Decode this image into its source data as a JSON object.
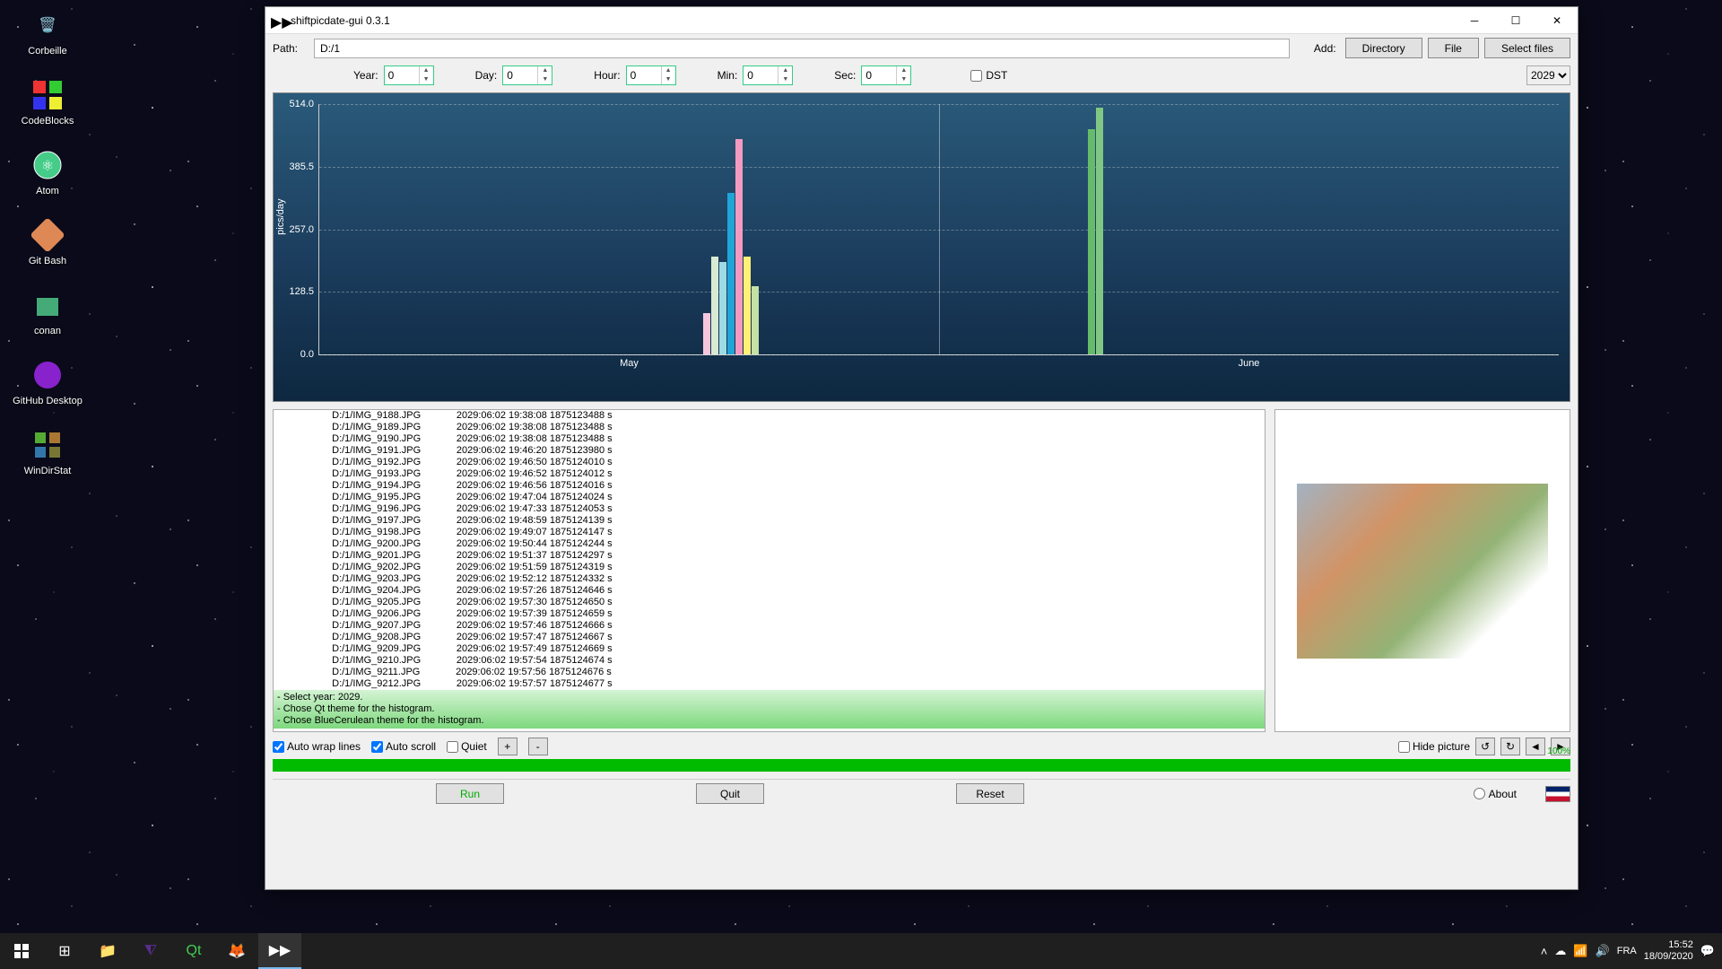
{
  "desktop": {
    "icons": [
      "Corbeille",
      "CodeBlocks",
      "Atom",
      "Git Bash",
      "conan",
      "GitHub Desktop",
      "WinDirStat"
    ]
  },
  "window": {
    "title": "shiftpicdate-gui 0.3.1",
    "path_label": "Path:",
    "path_value": "D:/1",
    "add_label": "Add:",
    "directory_btn": "Directory",
    "file_btn": "File",
    "select_files_btn": "Select files",
    "spinners": {
      "year": {
        "label": "Year:",
        "value": "0"
      },
      "day": {
        "label": "Day:",
        "value": "0"
      },
      "hour": {
        "label": "Hour:",
        "value": "0"
      },
      "min": {
        "label": "Min:",
        "value": "0"
      },
      "sec": {
        "label": "Sec:",
        "value": "0"
      }
    },
    "dst_label": "DST",
    "year_select": "2029"
  },
  "chart_data": {
    "type": "bar",
    "ylabel": "pics/day",
    "ylim": [
      0,
      514
    ],
    "yticks": [
      0.0,
      128.5,
      257.0,
      385.5,
      514.0
    ],
    "xticks": [
      "May",
      "June"
    ],
    "bar_groups": [
      {
        "pos_pct": 31,
        "bars": [
          {
            "value": 85,
            "color": "#f7c6dc"
          },
          {
            "value": 200,
            "color": "#d9ead3"
          },
          {
            "value": 190,
            "color": "#9edae5"
          },
          {
            "value": 330,
            "color": "#1fa5d8"
          },
          {
            "value": 440,
            "color": "#f49ac1"
          },
          {
            "value": 200,
            "color": "#fff176"
          },
          {
            "value": 140,
            "color": "#c5e1a5"
          }
        ]
      },
      {
        "pos_pct": 62,
        "bars": [
          {
            "value": 460,
            "color": "#66bb6a"
          },
          {
            "value": 505,
            "color": "#81c784"
          }
        ]
      }
    ]
  },
  "log": {
    "rows": [
      {
        "f": "D:/1/IMG_9188.JPG",
        "d": "2029:06:02 19:38:08",
        "s": "1875123488 s"
      },
      {
        "f": "D:/1/IMG_9189.JPG",
        "d": "2029:06:02 19:38:08",
        "s": "1875123488 s"
      },
      {
        "f": "D:/1/IMG_9190.JPG",
        "d": "2029:06:02 19:38:08",
        "s": "1875123488 s"
      },
      {
        "f": "D:/1/IMG_9191.JPG",
        "d": "2029:06:02 19:46:20",
        "s": "1875123980 s"
      },
      {
        "f": "D:/1/IMG_9192.JPG",
        "d": "2029:06:02 19:46:50",
        "s": "1875124010 s"
      },
      {
        "f": "D:/1/IMG_9193.JPG",
        "d": "2029:06:02 19:46:52",
        "s": "1875124012 s"
      },
      {
        "f": "D:/1/IMG_9194.JPG",
        "d": "2029:06:02 19:46:56",
        "s": "1875124016 s"
      },
      {
        "f": "D:/1/IMG_9195.JPG",
        "d": "2029:06:02 19:47:04",
        "s": "1875124024 s"
      },
      {
        "f": "D:/1/IMG_9196.JPG",
        "d": "2029:06:02 19:47:33",
        "s": "1875124053 s"
      },
      {
        "f": "D:/1/IMG_9197.JPG",
        "d": "2029:06:02 19:48:59",
        "s": "1875124139 s"
      },
      {
        "f": "D:/1/IMG_9198.JPG",
        "d": "2029:06:02 19:49:07",
        "s": "1875124147 s"
      },
      {
        "f": "D:/1/IMG_9200.JPG",
        "d": "2029:06:02 19:50:44",
        "s": "1875124244 s"
      },
      {
        "f": "D:/1/IMG_9201.JPG",
        "d": "2029:06:02 19:51:37",
        "s": "1875124297 s"
      },
      {
        "f": "D:/1/IMG_9202.JPG",
        "d": "2029:06:02 19:51:59",
        "s": "1875124319 s"
      },
      {
        "f": "D:/1/IMG_9203.JPG",
        "d": "2029:06:02 19:52:12",
        "s": "1875124332 s"
      },
      {
        "f": "D:/1/IMG_9204.JPG",
        "d": "2029:06:02 19:57:26",
        "s": "1875124646 s"
      },
      {
        "f": "D:/1/IMG_9205.JPG",
        "d": "2029:06:02 19:57:30",
        "s": "1875124650 s"
      },
      {
        "f": "D:/1/IMG_9206.JPG",
        "d": "2029:06:02 19:57:39",
        "s": "1875124659 s"
      },
      {
        "f": "D:/1/IMG_9207.JPG",
        "d": "2029:06:02 19:57:46",
        "s": "1875124666 s"
      },
      {
        "f": "D:/1/IMG_9208.JPG",
        "d": "2029:06:02 19:57:47",
        "s": "1875124667 s"
      },
      {
        "f": "D:/1/IMG_9209.JPG",
        "d": "2029:06:02 19:57:49",
        "s": "1875124669 s"
      },
      {
        "f": "D:/1/IMG_9210.JPG",
        "d": "2029:06:02 19:57:54",
        "s": "1875124674 s"
      },
      {
        "f": "D:/1/IMG_9211.JPG",
        "d": "2029:06:02 19:57:56",
        "s": "1875124676 s"
      },
      {
        "f": "D:/1/IMG_9212.JPG",
        "d": "2029:06:02 19:57:57",
        "s": "1875124677 s"
      }
    ],
    "status": [
      "- Select year: 2029.",
      "- Chose Qt theme for the histogram.",
      "- Chose BlueCerulean theme for the histogram."
    ]
  },
  "options": {
    "auto_wrap": "Auto wrap lines",
    "auto_scroll": "Auto scroll",
    "quiet": "Quiet",
    "hide_picture": "Hide picture",
    "plus_btn": "+",
    "minus_btn": "-",
    "rotate_left": "↺",
    "rotate_right": "↻",
    "prev": "◄",
    "next": "►"
  },
  "progress_pct": "100%",
  "actions": {
    "run": "Run",
    "quit": "Quit",
    "reset": "Reset",
    "about": "About"
  },
  "taskbar": {
    "lang": "FRA",
    "time": "15:52",
    "date": "18/09/2020"
  }
}
